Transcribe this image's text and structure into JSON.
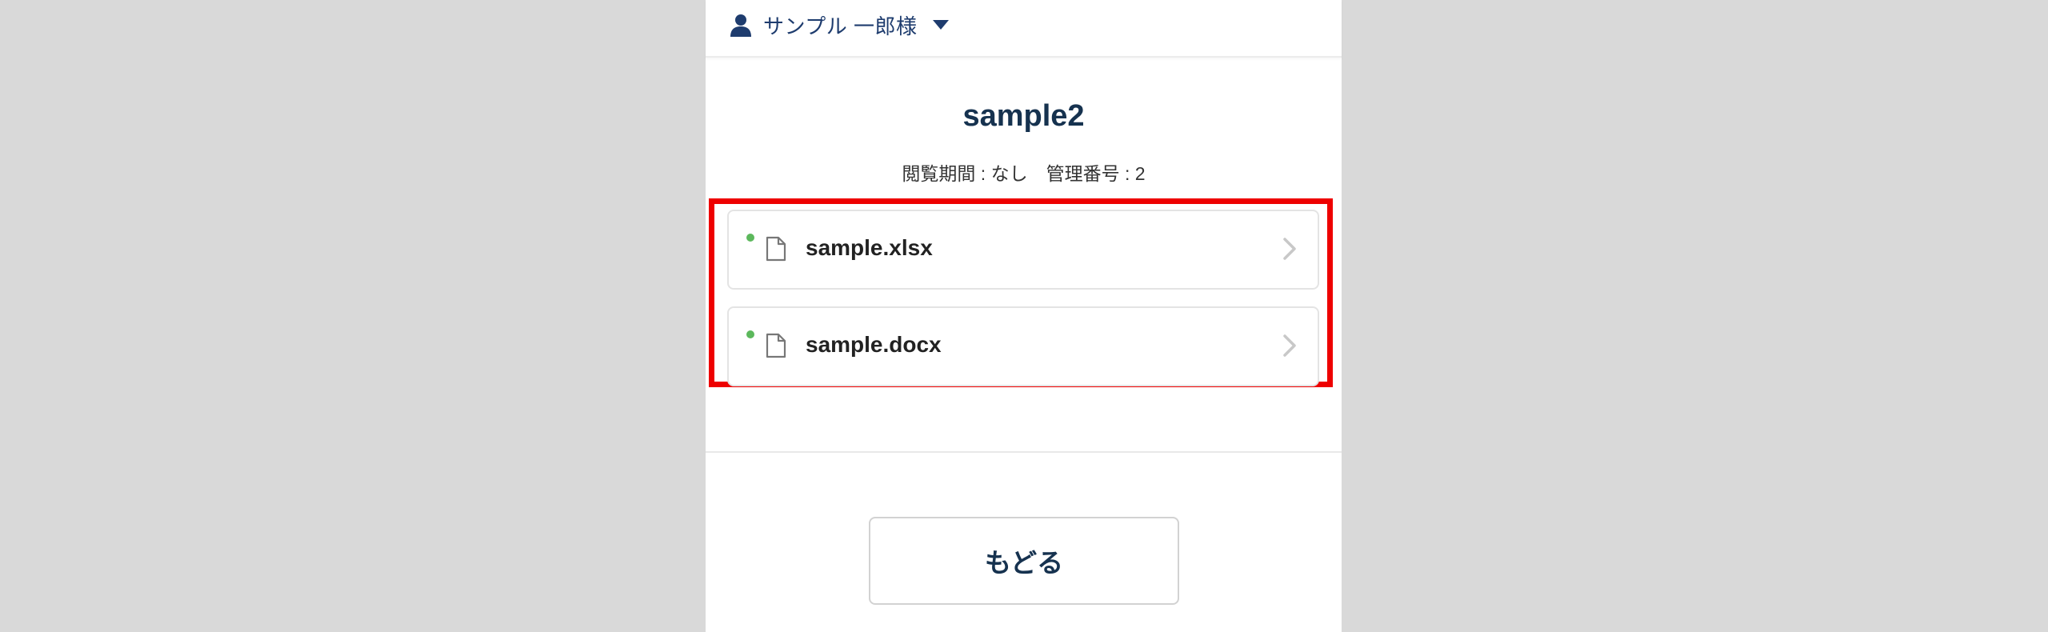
{
  "user_menu": {
    "name": "サンプル 一郎様",
    "icon": "user-icon",
    "caret_icon": "caret-down-icon"
  },
  "document": {
    "title": "sample2",
    "view_period_label": "閲覧期間",
    "view_period_value": "なし",
    "management_no_label": "管理番号",
    "management_no_value": "2",
    "separator": " : "
  },
  "files": [
    {
      "name": "sample.xlsx",
      "status": "new",
      "icon": "file-icon"
    },
    {
      "name": "sample.docx",
      "status": "new",
      "icon": "file-icon"
    }
  ],
  "actions": {
    "back_label": "もどる"
  },
  "colors": {
    "highlight": "#ee0000",
    "status_dot": "#5cb85c",
    "title": "#16324f",
    "user_name": "#1e3c6e"
  }
}
